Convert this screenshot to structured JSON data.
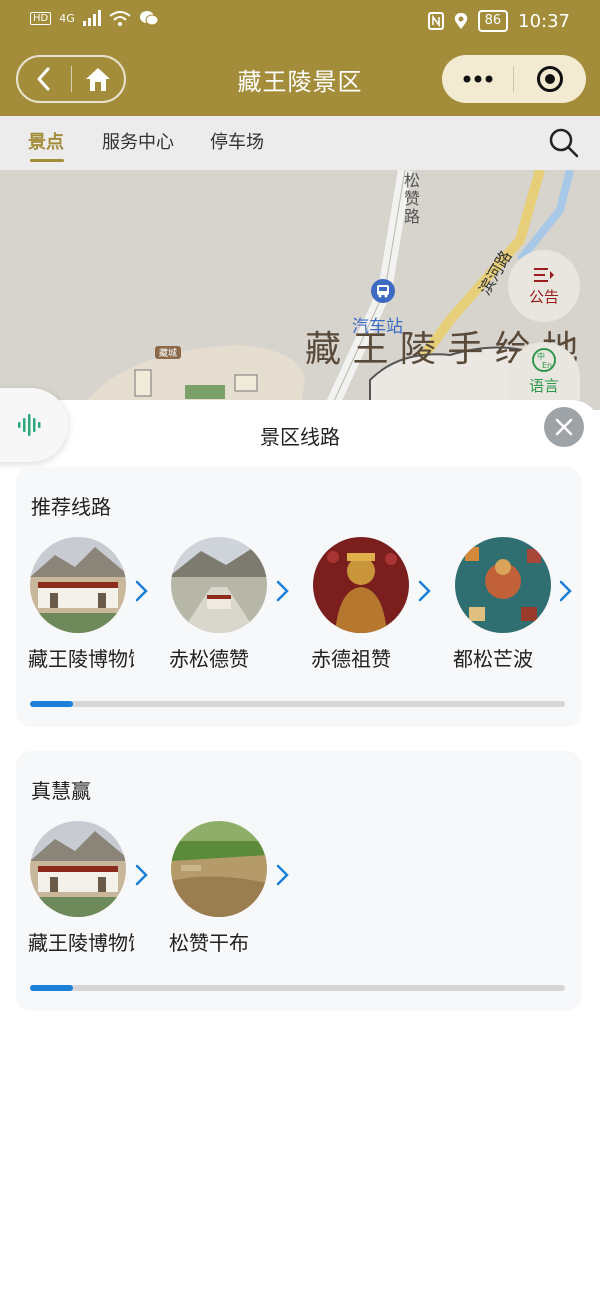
{
  "status_bar": {
    "network": "4G",
    "battery": "86",
    "time": "10:37"
  },
  "header": {
    "title": "藏王陵景区"
  },
  "tabs": [
    {
      "label": "景点",
      "active": true
    },
    {
      "label": "服务中心",
      "active": false
    },
    {
      "label": "停车场",
      "active": false
    }
  ],
  "map": {
    "road_left": "松赞路",
    "road_right": "滨河路",
    "bus_station": "汽车站",
    "handwritten": "藏 王 陵  手 绘 地",
    "small_sign": "藏城",
    "side_buttons": [
      {
        "icon": "announcement-icon",
        "label": "公告"
      },
      {
        "icon": "language-icon",
        "label": "语言"
      }
    ]
  },
  "panel": {
    "title": "景区线路",
    "routes": [
      {
        "title": "推荐线路",
        "stops": [
          "藏王陵博物馆",
          "赤松德赞",
          "赤德祖赞",
          "都松芒波"
        ],
        "progress": 0.08
      },
      {
        "title": "真慧赢",
        "stops": [
          "藏王陵博物馆",
          "松赞干布"
        ],
        "progress": 0.08
      }
    ]
  },
  "colors": {
    "accent": "#a48d3a",
    "progress": "#1a80d8",
    "arrow": "#1a80d8"
  }
}
